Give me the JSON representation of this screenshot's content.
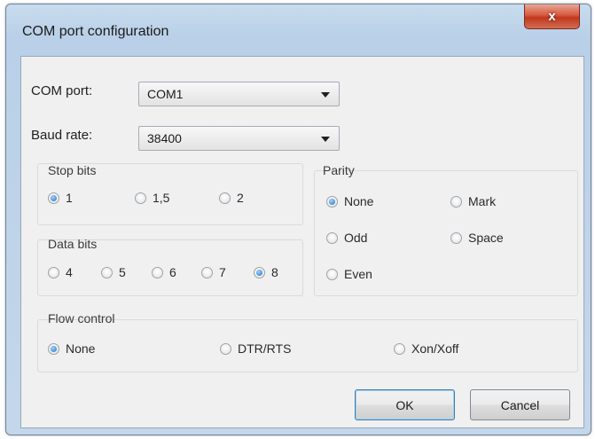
{
  "window": {
    "title": "COM port configuration",
    "close_label": "x"
  },
  "com_port": {
    "label": "COM port:",
    "value": "COM1"
  },
  "baud_rate": {
    "label": "Baud rate:",
    "value": "38400"
  },
  "stop_bits": {
    "title": "Stop bits",
    "options": [
      {
        "label": "1",
        "selected": true
      },
      {
        "label": "1,5",
        "selected": false
      },
      {
        "label": "2",
        "selected": false
      }
    ]
  },
  "data_bits": {
    "title": "Data bits",
    "options": [
      {
        "label": "4",
        "selected": false
      },
      {
        "label": "5",
        "selected": false
      },
      {
        "label": "6",
        "selected": false
      },
      {
        "label": "7",
        "selected": false
      },
      {
        "label": "8",
        "selected": true
      }
    ]
  },
  "parity": {
    "title": "Parity",
    "options": [
      {
        "label": "None",
        "selected": true
      },
      {
        "label": "Mark",
        "selected": false
      },
      {
        "label": "Odd",
        "selected": false
      },
      {
        "label": "Space",
        "selected": false
      },
      {
        "label": "Even",
        "selected": false
      }
    ]
  },
  "flow_control": {
    "title": "Flow control",
    "options": [
      {
        "label": "None",
        "selected": true
      },
      {
        "label": "DTR/RTS",
        "selected": false
      },
      {
        "label": "Xon/Xoff",
        "selected": false
      }
    ]
  },
  "buttons": {
    "ok": "OK",
    "cancel": "Cancel"
  },
  "colors": {
    "accent": "#1f6fc2",
    "close_button": "#c0381f",
    "frame": "#b9d0e8"
  }
}
